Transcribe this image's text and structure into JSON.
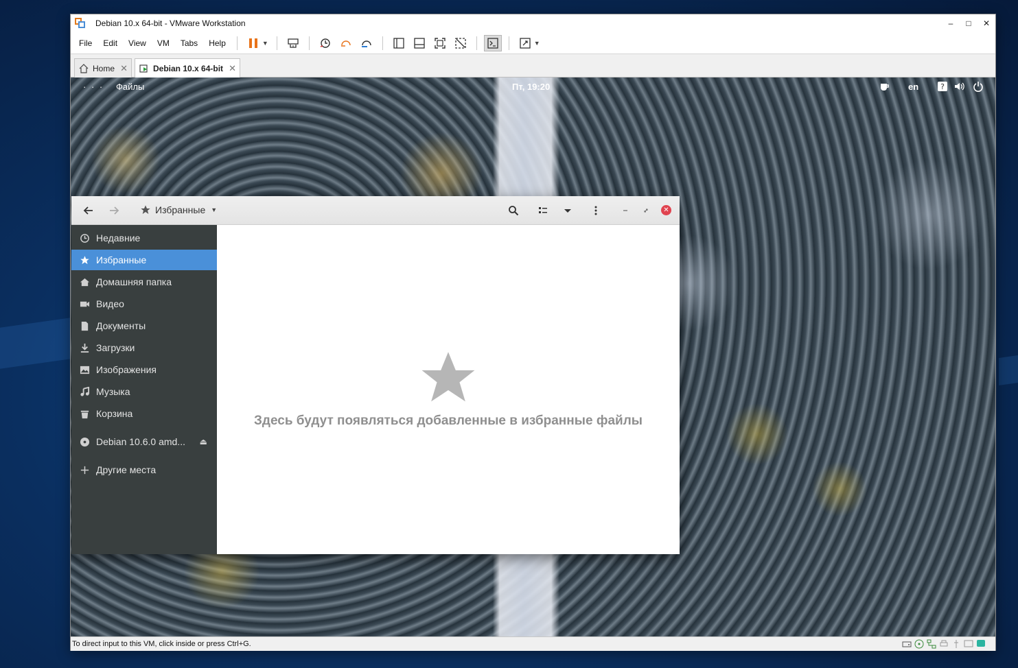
{
  "host_window": {
    "title": "Debian 10.x 64-bit - VMware Workstation",
    "controls": {
      "minimize": "–",
      "maximize": "□",
      "close": "✕"
    }
  },
  "menu": [
    "File",
    "Edit",
    "View",
    "VM",
    "Tabs",
    "Help"
  ],
  "tabs": [
    {
      "label": "Home",
      "close": "✕"
    },
    {
      "label": "Debian 10.x 64-bit",
      "close": "✕"
    }
  ],
  "guest": {
    "topbar": {
      "activities": "· · ·",
      "app": "Файлы",
      "clock": "Пт, 19:20",
      "lang": "en"
    },
    "files": {
      "location": "Избранные",
      "sidebar": [
        {
          "label": "Недавние",
          "icon": "clock-icon"
        },
        {
          "label": "Избранные",
          "icon": "star-icon"
        },
        {
          "label": "Домашняя папка",
          "icon": "home-icon"
        },
        {
          "label": "Видео",
          "icon": "video-icon"
        },
        {
          "label": "Документы",
          "icon": "document-icon"
        },
        {
          "label": "Загрузки",
          "icon": "download-icon"
        },
        {
          "label": "Изображения",
          "icon": "image-icon"
        },
        {
          "label": "Музыка",
          "icon": "music-icon"
        },
        {
          "label": "Корзина",
          "icon": "trash-icon"
        },
        {
          "label": "Debian 10.6.0 amd...",
          "icon": "disc-icon"
        },
        {
          "label": "Другие места",
          "icon": "plus-icon"
        }
      ],
      "empty_message": "Здесь будут появляться добавленные в избранные файлы"
    }
  },
  "status_bar": {
    "text": "To direct input to this VM, click inside or press Ctrl+G."
  },
  "colors": {
    "selected": "#4a90d9",
    "sidebar_bg": "#393f3f",
    "pause_orange": "#e8731a",
    "close_red": "#e0434f"
  }
}
